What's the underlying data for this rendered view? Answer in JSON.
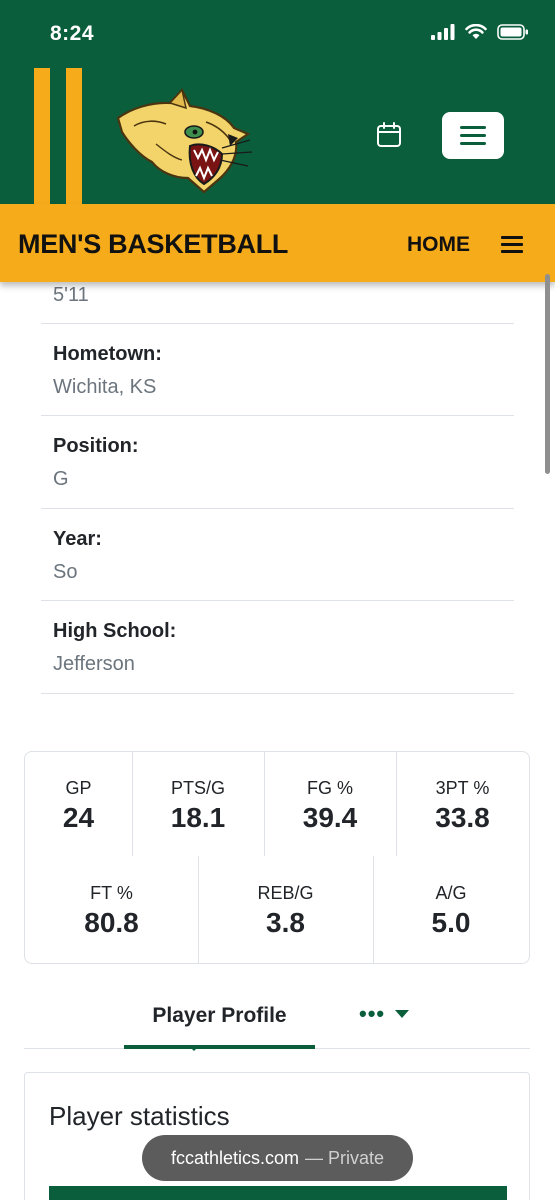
{
  "status_bar": {
    "time": "8:24"
  },
  "header": {
    "logo_icon": "cougar-mascot-logo",
    "calendar_icon": "calendar-icon",
    "menu_icon": "hamburger-menu-icon"
  },
  "colors": {
    "brand_green": "#0b5e3c",
    "brand_gold": "#f6ab1b"
  },
  "sport_bar": {
    "title": "MEN'S BASKETBALL",
    "home_label": "HOME"
  },
  "bio": {
    "height_value": "5'11",
    "fields": [
      {
        "label": "Hometown:",
        "value": "Wichita, KS"
      },
      {
        "label": "Position:",
        "value": "G"
      },
      {
        "label": "Year:",
        "value": "So"
      },
      {
        "label": "High School:",
        "value": "Jefferson"
      }
    ]
  },
  "stats": [
    {
      "label": "GP",
      "value": "24"
    },
    {
      "label": "PTS/G",
      "value": "18.1"
    },
    {
      "label": "FG %",
      "value": "39.4"
    },
    {
      "label": "3PT %",
      "value": "33.8"
    },
    {
      "label": "FT %",
      "value": "80.8"
    },
    {
      "label": "REB/G",
      "value": "3.8"
    },
    {
      "label": "A/G",
      "value": "5.0"
    }
  ],
  "tabs": {
    "active": "Player Profile",
    "more": "•••"
  },
  "stats_panel": {
    "title": "Player statistics"
  },
  "browser": {
    "domain": "fccathletics.com",
    "mode": "— Private"
  }
}
